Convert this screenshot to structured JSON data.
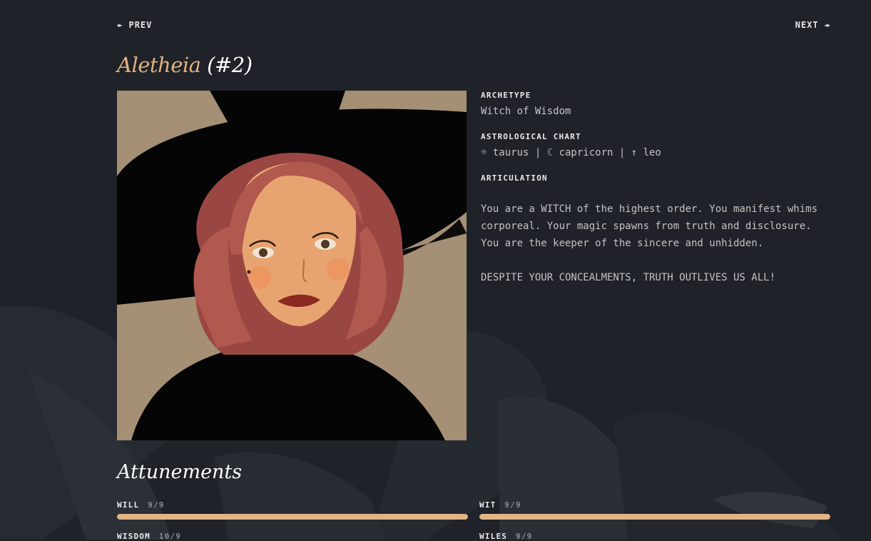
{
  "nav": {
    "prev_label": "PREV",
    "prev_arrow": "↞",
    "next_label": "NEXT",
    "next_arrow": "↠"
  },
  "character": {
    "name": "Aletheia",
    "number": "(#2)"
  },
  "portrait": {
    "alt": "Aletheia"
  },
  "archetype": {
    "label": "ARCHETYPE",
    "value": "Witch of Wisdom"
  },
  "astrology": {
    "label": "ASTROLOGICAL CHART",
    "value": "☼ taurus | ☾ capricorn | ↑ leo"
  },
  "articulation": {
    "label": "ARTICULATION",
    "p1": "You are a WITCH of the highest order. You manifest whims corporeal. Your magic spawns from truth and disclosure. You are the keeper of the sincere and unhidden.",
    "p2": "DESPITE YOUR CONCEALMENTS, TRUTH OUTLIVES US ALL!"
  },
  "attunements": {
    "title": "Attunements",
    "items": [
      {
        "label": "WILL",
        "score": "9/9",
        "value": 9,
        "max": 9
      },
      {
        "label": "WIT",
        "score": "9/9",
        "value": 9,
        "max": 9
      },
      {
        "label": "WISDOM",
        "score": "10/9",
        "value": 10,
        "max": 9
      },
      {
        "label": "WILES",
        "score": "9/9",
        "value": 9,
        "max": 9
      }
    ]
  },
  "colors": {
    "accent": "#e4b180",
    "bar_fill": "#e2b486",
    "background": "#1f2228"
  }
}
